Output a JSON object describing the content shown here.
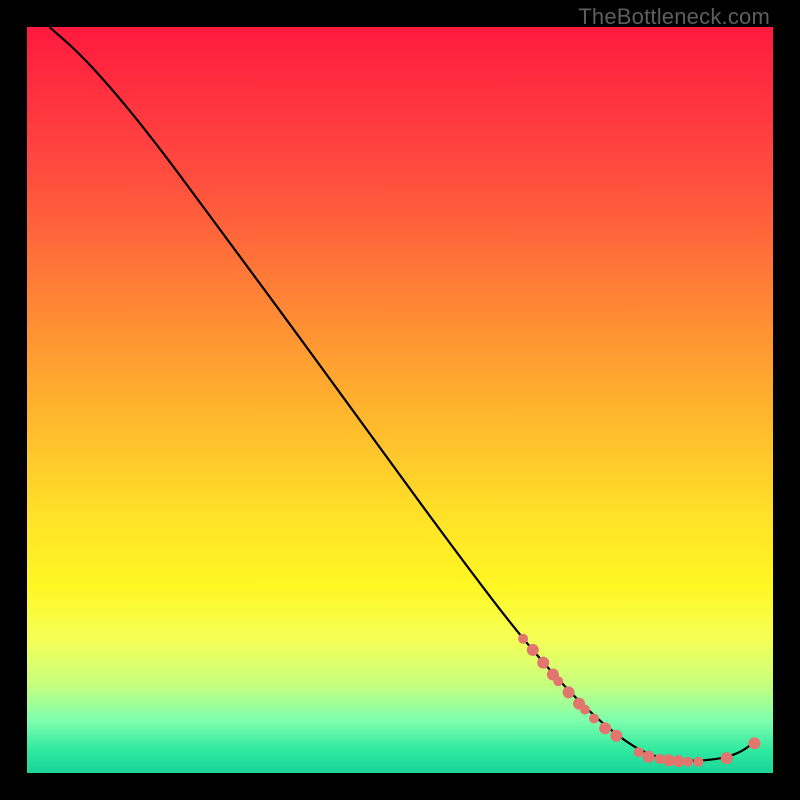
{
  "watermark": "TheBottleneck.com",
  "chart_data": {
    "type": "line",
    "title": "",
    "xlabel": "",
    "ylabel": "",
    "xlim": [
      0,
      100
    ],
    "ylim": [
      0,
      100
    ],
    "grid": false,
    "legend": "none",
    "gradient_stops": [
      {
        "offset": 0,
        "color": "#ff1a3f"
      },
      {
        "offset": 20,
        "color": "#ff4d3f"
      },
      {
        "offset": 45,
        "color": "#ffa030"
      },
      {
        "offset": 65,
        "color": "#ffe028"
      },
      {
        "offset": 75,
        "color": "#fff724"
      },
      {
        "offset": 82,
        "color": "#f5ff55"
      },
      {
        "offset": 88,
        "color": "#c8ff7d"
      },
      {
        "offset": 93,
        "color": "#7dffad"
      },
      {
        "offset": 97,
        "color": "#2fe8a0"
      },
      {
        "offset": 100,
        "color": "#1ad49a"
      }
    ],
    "series": [
      {
        "name": "curve",
        "stroke": "#000000",
        "points": [
          {
            "x": 3.0,
            "y": 100.0
          },
          {
            "x": 7.0,
            "y": 96.5
          },
          {
            "x": 12.0,
            "y": 91.0
          },
          {
            "x": 18.0,
            "y": 83.5
          },
          {
            "x": 25.0,
            "y": 74.0
          },
          {
            "x": 35.0,
            "y": 60.5
          },
          {
            "x": 47.0,
            "y": 44.0
          },
          {
            "x": 58.0,
            "y": 29.0
          },
          {
            "x": 66.0,
            "y": 18.5
          },
          {
            "x": 73.0,
            "y": 10.5
          },
          {
            "x": 79.0,
            "y": 5.0
          },
          {
            "x": 84.0,
            "y": 2.0
          },
          {
            "x": 90.0,
            "y": 1.5
          },
          {
            "x": 95.0,
            "y": 2.3
          },
          {
            "x": 98.0,
            "y": 4.5
          }
        ]
      }
    ],
    "markers": {
      "color": "#e2766f",
      "radius_small": 5,
      "radius_large": 6,
      "points": [
        {
          "x": 66.5,
          "y": 18.0,
          "r": "small"
        },
        {
          "x": 67.8,
          "y": 16.5,
          "r": "large"
        },
        {
          "x": 69.2,
          "y": 14.8,
          "r": "large"
        },
        {
          "x": 70.5,
          "y": 13.2,
          "r": "large"
        },
        {
          "x": 71.2,
          "y": 12.3,
          "r": "small"
        },
        {
          "x": 72.6,
          "y": 10.8,
          "r": "large"
        },
        {
          "x": 74.0,
          "y": 9.3,
          "r": "large"
        },
        {
          "x": 74.8,
          "y": 8.5,
          "r": "small"
        },
        {
          "x": 76.0,
          "y": 7.3,
          "r": "small"
        },
        {
          "x": 77.5,
          "y": 6.0,
          "r": "large"
        },
        {
          "x": 79.0,
          "y": 5.0,
          "r": "large"
        },
        {
          "x": 82.0,
          "y": 2.8,
          "r": "small"
        },
        {
          "x": 83.3,
          "y": 2.2,
          "r": "large"
        },
        {
          "x": 84.8,
          "y": 1.9,
          "r": "small"
        },
        {
          "x": 86.0,
          "y": 1.7,
          "r": "large"
        },
        {
          "x": 87.3,
          "y": 1.6,
          "r": "large"
        },
        {
          "x": 88.6,
          "y": 1.5,
          "r": "small"
        },
        {
          "x": 90.0,
          "y": 1.5,
          "r": "small"
        },
        {
          "x": 93.8,
          "y": 2.0,
          "r": "large"
        },
        {
          "x": 97.5,
          "y": 4.0,
          "r": "large"
        }
      ]
    }
  }
}
